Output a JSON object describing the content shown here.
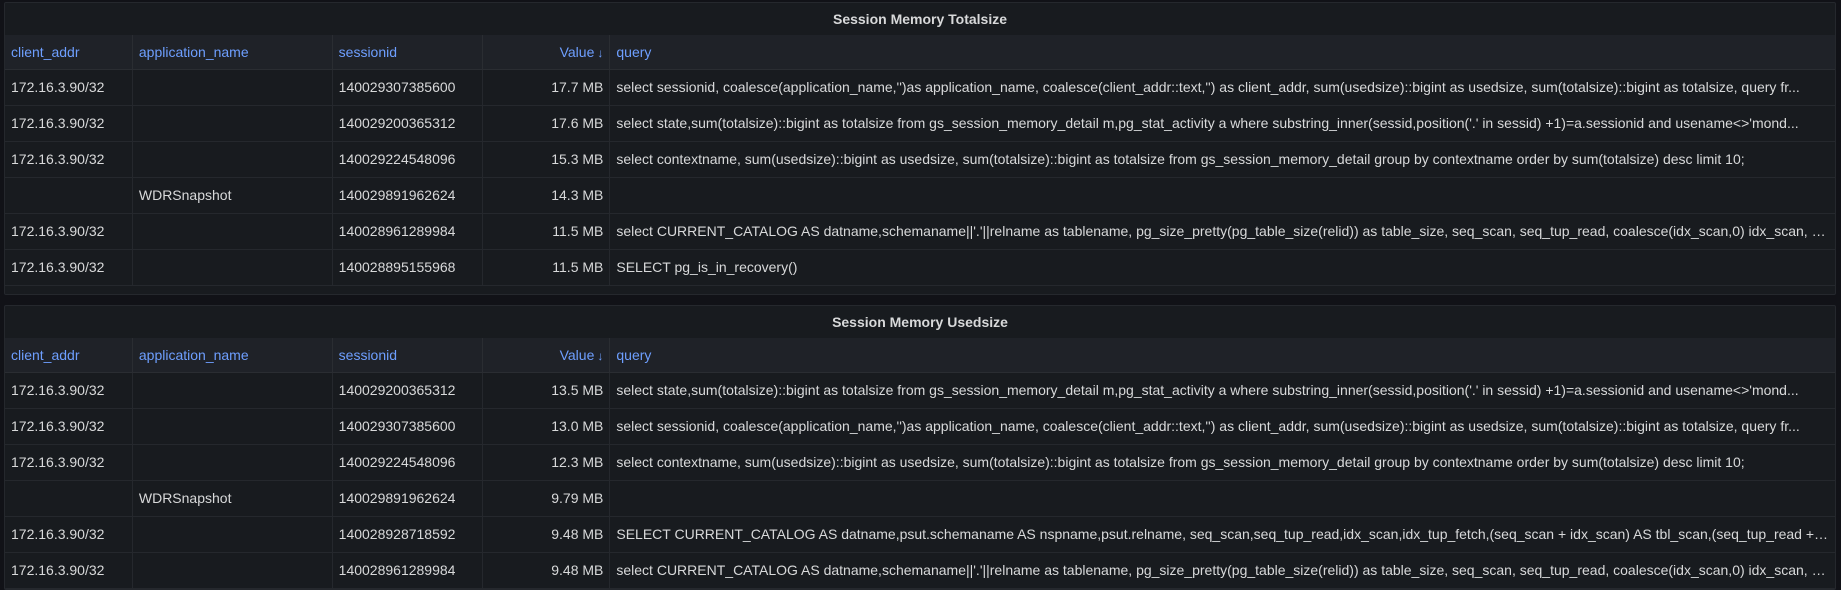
{
  "panels": [
    {
      "title": "Session Memory Totalsize",
      "columns": [
        "client_addr",
        "application_name",
        "sessionid",
        "Value",
        "query"
      ],
      "sort_indicator": "↓",
      "rows": [
        [
          "172.16.3.90/32",
          "",
          "140029307385600",
          "17.7 MB",
          "select sessionid, coalesce(application_name,'')as application_name, coalesce(client_addr::text,'') as client_addr, sum(usedsize)::bigint as usedsize, sum(totalsize)::bigint as totalsize, query fr..."
        ],
        [
          "172.16.3.90/32",
          "",
          "140029200365312",
          "17.6 MB",
          "select state,sum(totalsize)::bigint as totalsize from gs_session_memory_detail m,pg_stat_activity a where substring_inner(sessid,position('.' in sessid) +1)=a.sessionid and usename<>'mond..."
        ],
        [
          "172.16.3.90/32",
          "",
          "140029224548096",
          "15.3 MB",
          "select contextname, sum(usedsize)::bigint as usedsize, sum(totalsize)::bigint as totalsize from gs_session_memory_detail group by contextname order by sum(totalsize) desc limit 10;"
        ],
        [
          "",
          "WDRSnapshot",
          "140029891962624",
          "14.3 MB",
          ""
        ],
        [
          "172.16.3.90/32",
          "",
          "140028961289984",
          "11.5 MB",
          "select CURRENT_CATALOG AS datname,schemaname||'.'||relname as tablename, pg_size_pretty(pg_table_size(relid)) as table_size, seq_scan, seq_tup_read, coalesce(idx_scan,0) idx_scan, c..."
        ],
        [
          "172.16.3.90/32",
          "",
          "140028895155968",
          "11.5 MB",
          "SELECT pg_is_in_recovery()"
        ]
      ]
    },
    {
      "title": "Session Memory Usedsize",
      "columns": [
        "client_addr",
        "application_name",
        "sessionid",
        "Value",
        "query"
      ],
      "sort_indicator": "↓",
      "rows": [
        [
          "172.16.3.90/32",
          "",
          "140029200365312",
          "13.5 MB",
          "select state,sum(totalsize)::bigint as totalsize from gs_session_memory_detail m,pg_stat_activity a where substring_inner(sessid,position('.' in sessid) +1)=a.sessionid and usename<>'mond..."
        ],
        [
          "172.16.3.90/32",
          "",
          "140029307385600",
          "13.0 MB",
          "select sessionid, coalesce(application_name,'')as application_name, coalesce(client_addr::text,'') as client_addr, sum(usedsize)::bigint as usedsize, sum(totalsize)::bigint as totalsize, query fr..."
        ],
        [
          "172.16.3.90/32",
          "",
          "140029224548096",
          "12.3 MB",
          "select contextname, sum(usedsize)::bigint as usedsize, sum(totalsize)::bigint as totalsize from gs_session_memory_detail group by contextname order by sum(totalsize) desc limit 10;"
        ],
        [
          "",
          "WDRSnapshot",
          "140029891962624",
          "9.79 MB",
          ""
        ],
        [
          "172.16.3.90/32",
          "",
          "140028928718592",
          "9.48 MB",
          "SELECT CURRENT_CATALOG AS datname,psut.schemaname AS nspname,psut.relname, seq_scan,seq_tup_read,idx_scan,idx_tup_fetch,(seq_scan + idx_scan) AS tbl_scan,(seq_tup_read + id..."
        ],
        [
          "172.16.3.90/32",
          "",
          "140028961289984",
          "9.48 MB",
          "select CURRENT_CATALOG AS datname,schemaname||'.'||relname as tablename, pg_size_pretty(pg_table_size(relid)) as table_size, seq_scan, seq_tup_read, coalesce(idx_scan,0) idx_scan, c..."
        ]
      ]
    }
  ]
}
